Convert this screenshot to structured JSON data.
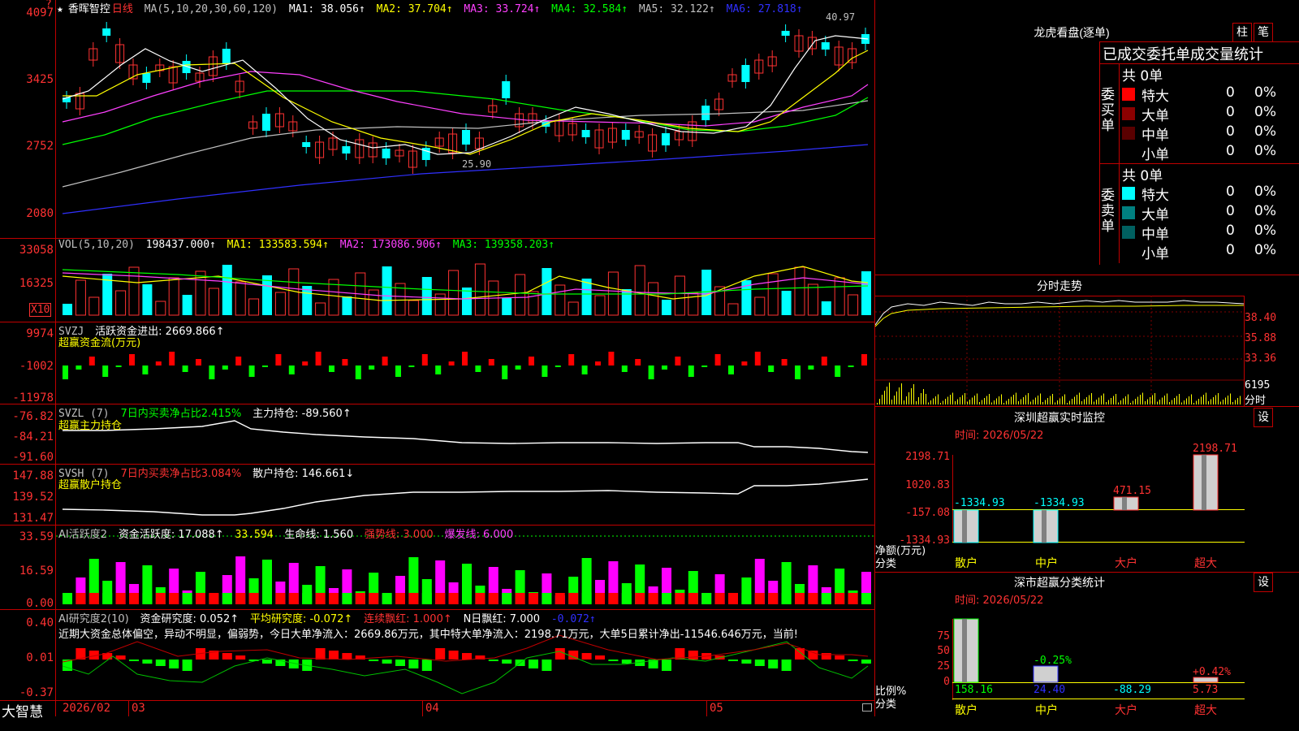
{
  "title_row": {
    "star": "★",
    "stock_name": "香晖智控",
    "period": "日线",
    "ma_spec": "MA(5,10,20,30,60,120)",
    "ma1": "MA1: 38.056↑",
    "ma2": "MA2: 37.704↑",
    "ma3": "MA3: 33.724↑",
    "ma4": "MA4: 32.584↑",
    "ma5": "MA5: 32.122↑",
    "ma6": "MA6: 27.818↑",
    "top_marker": "?"
  },
  "colors": {
    "red": "#ff3232",
    "cyan": "#00ffff",
    "green": "#00ff00",
    "magenta": "#ff40ff",
    "yellow": "#ffff00",
    "blue": "#3030ff",
    "white": "#ffffff",
    "gray": "#c0c0c0"
  },
  "price_axis": [
    "4097",
    "3425",
    "2752",
    "2080"
  ],
  "price_annotations": {
    "high": "40.97",
    "low": "25.90"
  },
  "vol_row": {
    "spec": "VOL(5,10,20)",
    "val": "198437.000↑",
    "ma1": "MA1: 133583.594↑",
    "ma2": "MA2: 173086.906↑",
    "ma3": "MA3: 139358.203↑"
  },
  "vol_axis": [
    "33058",
    "16325"
  ],
  "vol_unit": "X10",
  "svzj": {
    "spec": "SVZJ",
    "label": "活跃资金进出: 2669.866↑",
    "sub": "超赢资金流(万元)",
    "axis": [
      "9974",
      "-1002",
      "-11978"
    ]
  },
  "svzl": {
    "spec": "SVZL (7)",
    "pct": "7日内买卖净占比2.415%",
    "main": "主力持仓: -89.560↑",
    "sub": "超赢主力持仓",
    "axis": [
      "-76.82",
      "-84.21",
      "-91.60"
    ]
  },
  "svsh": {
    "spec": "SVSH (7)",
    "pct": "7日内买卖净占比3.084%",
    "retail": "散户持仓: 146.661↓",
    "sub": "超赢散户持仓",
    "axis": [
      "147.88",
      "139.52",
      "131.47"
    ]
  },
  "ai1": {
    "spec": "AI活跃度2",
    "a": "资金活跃度: 17.088↑",
    "b": "33.594",
    "c": "生命线: 1.560",
    "d": "强势线: 3.000",
    "e": "爆发线: 6.000",
    "axis": [
      "33.59",
      "16.59",
      "0.00"
    ]
  },
  "ai2": {
    "spec": "AI研究度2(10)",
    "a": "资金研究度: 0.052↑",
    "b": "平均研究度: -0.072↑",
    "c": "连续飘红: 1.000↑",
    "d": "N日飘红: 7.000",
    "e": "-0.072↑",
    "axis": [
      "0.40",
      "0.01",
      "-0.37"
    ],
    "comment": "近期大资金总体偏空，异动不明显，偏弱势，今日大单净流入：2669.86万元，其中特大单净流入：2198.71万元，大单5日累计净出-11546.646万元，当前!"
  },
  "bottom_bar": {
    "brand": "大智慧",
    "dates": [
      "2026/02",
      "03",
      "04",
      "05"
    ]
  },
  "right": {
    "lhb_title": "龙虎看盘(逐单)",
    "btn1": "柱",
    "btn2": "笔",
    "tabs": "已成交委托单成交量统计",
    "buy_label": "委买单",
    "sell_label": "委卖单",
    "buy_total": "共 0单",
    "sell_total": "共 0单",
    "rows": [
      {
        "name": "特大",
        "qty": "0",
        "pct": "0%"
      },
      {
        "name": "大单",
        "qty": "0",
        "pct": "0%"
      },
      {
        "name": "中单",
        "qty": "0",
        "pct": "0%"
      },
      {
        "name": "小单",
        "qty": "0",
        "pct": "0%"
      }
    ],
    "intraday_title": "分时走势",
    "intraday_axis": [
      "38.40",
      "35.88",
      "33.36",
      "6195",
      "分时"
    ],
    "sz_title": "深圳超赢实时监控",
    "settings": "设",
    "sz_time": "时间: 2026/05/22",
    "sz_axis": [
      "2198.71",
      "1020.83",
      "-157.08",
      "-1334.93"
    ],
    "sz_bars": [
      {
        "label": "散户",
        "value": "-1334.93"
      },
      {
        "label": "中户",
        "value": "-1334.93"
      },
      {
        "label": "大户",
        "value": "471.15"
      },
      {
        "label": "超大",
        "value": "2198.71"
      }
    ],
    "sz_footer1": "净额(万元)",
    "sz_footer2": "分类",
    "cls_title": "深市超赢分类统计",
    "cls_time": "时间: 2026/05/22",
    "cls_axis": [
      "75",
      "50",
      "25",
      "0"
    ],
    "cls_bars": [
      {
        "label": "散户",
        "value": "158.16",
        "pct": ""
      },
      {
        "label": "中户",
        "value": "24.40",
        "pct": "-0.25%"
      },
      {
        "label": "大户",
        "value": "-88.29",
        "pct": ""
      },
      {
        "label": "超大",
        "value": "5.73",
        "pct": "+0.42%"
      }
    ],
    "cls_footer1": "比例%",
    "cls_footer2": "分类"
  }
}
